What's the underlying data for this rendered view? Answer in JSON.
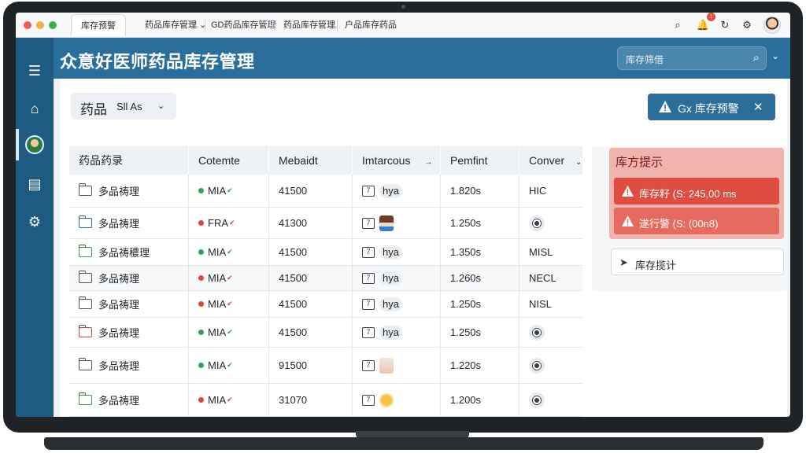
{
  "browser": {
    "tabs": [
      {
        "label": "库存预警",
        "active": true
      },
      {
        "label": "药品库存管理 ⌄",
        "active": false
      },
      {
        "label": "GD药品库存管理",
        "active": false
      },
      {
        "label": "药品库存管理",
        "active": false
      },
      {
        "label": "户品库存药品",
        "active": false
      }
    ],
    "notification_count": "1",
    "icons": [
      "search-icon",
      "bell-icon",
      "reload-icon",
      "gear-icon",
      "avatar"
    ]
  },
  "sidebar": {
    "items": [
      "menu-icon",
      "home-icon",
      "user-avatar",
      "calendar-icon",
      "settings-icon"
    ]
  },
  "header": {
    "title": "众意好医师药品库存管理",
    "search_placeholder": "库存筛借"
  },
  "toolbar": {
    "filter_label": "药品",
    "filter_value": "Sll As",
    "alert_button": "Gx 库存预警"
  },
  "table": {
    "columns": [
      "药品药录",
      "Cotemte",
      "Mebaidt",
      "Imtarcous",
      "Pemfint",
      "Conver"
    ],
    "rows": [
      {
        "name": "多品祷理",
        "status": "MIA",
        "status_color": "#2ea44f",
        "code": "41500",
        "imt": "hya",
        "imt_kind": "pill",
        "perf": "1.820s",
        "conv": "HIC",
        "conv_kind": "text"
      },
      {
        "name": "多品祷理",
        "status": "FRA",
        "status_color": "#e0443a",
        "code": "41300",
        "imt": "",
        "imt_kind": "jar",
        "perf": "1.250s",
        "conv": "",
        "conv_kind": "round"
      },
      {
        "name": "多品祷穠理",
        "status": "MIA",
        "status_color": "#2ea44f",
        "code": "41500",
        "imt": "hya",
        "imt_kind": "pill",
        "perf": "1.350s",
        "conv": "MISL",
        "conv_kind": "text"
      },
      {
        "name": "多品祷理",
        "status": "MIA",
        "status_color": "#e0443a",
        "code": "41500",
        "imt": "hya",
        "imt_kind": "pill",
        "perf": "1.260s",
        "conv": "NECL",
        "conv_kind": "text"
      },
      {
        "name": "多品祷理",
        "status": "MIA",
        "status_color": "#e0443a",
        "code": "41500",
        "imt": "hya",
        "imt_kind": "pill",
        "perf": "1.250s",
        "conv": "NISL",
        "conv_kind": "text"
      },
      {
        "name": "多品祷理",
        "status": "MIA",
        "status_color": "#2ea44f",
        "code": "41500",
        "imt": "hya",
        "imt_kind": "pill",
        "perf": "1.250s",
        "conv": "",
        "conv_kind": "round"
      },
      {
        "name": "多品祷理",
        "status": "MIA",
        "status_color": "#2ea44f",
        "code": "91500",
        "imt": "",
        "imt_kind": "box",
        "perf": "1.220s",
        "conv": "",
        "conv_kind": "round"
      },
      {
        "name": "多品祷理",
        "status": "MIA",
        "status_color": "#e0443a",
        "code": "31070",
        "imt": "",
        "imt_kind": "coin",
        "perf": "1.200s",
        "conv": "",
        "conv_kind": "round"
      }
    ]
  },
  "notice": {
    "title": "库方提示",
    "items": [
      "库存籽 (S: 245,00 ms",
      "遂行警 (S: (00n8)"
    ],
    "stat_button": "库存揽计"
  },
  "colors": {
    "brand": "#2a6f9b",
    "sidebar": "#1f5a82",
    "alert": "#e0443a"
  }
}
